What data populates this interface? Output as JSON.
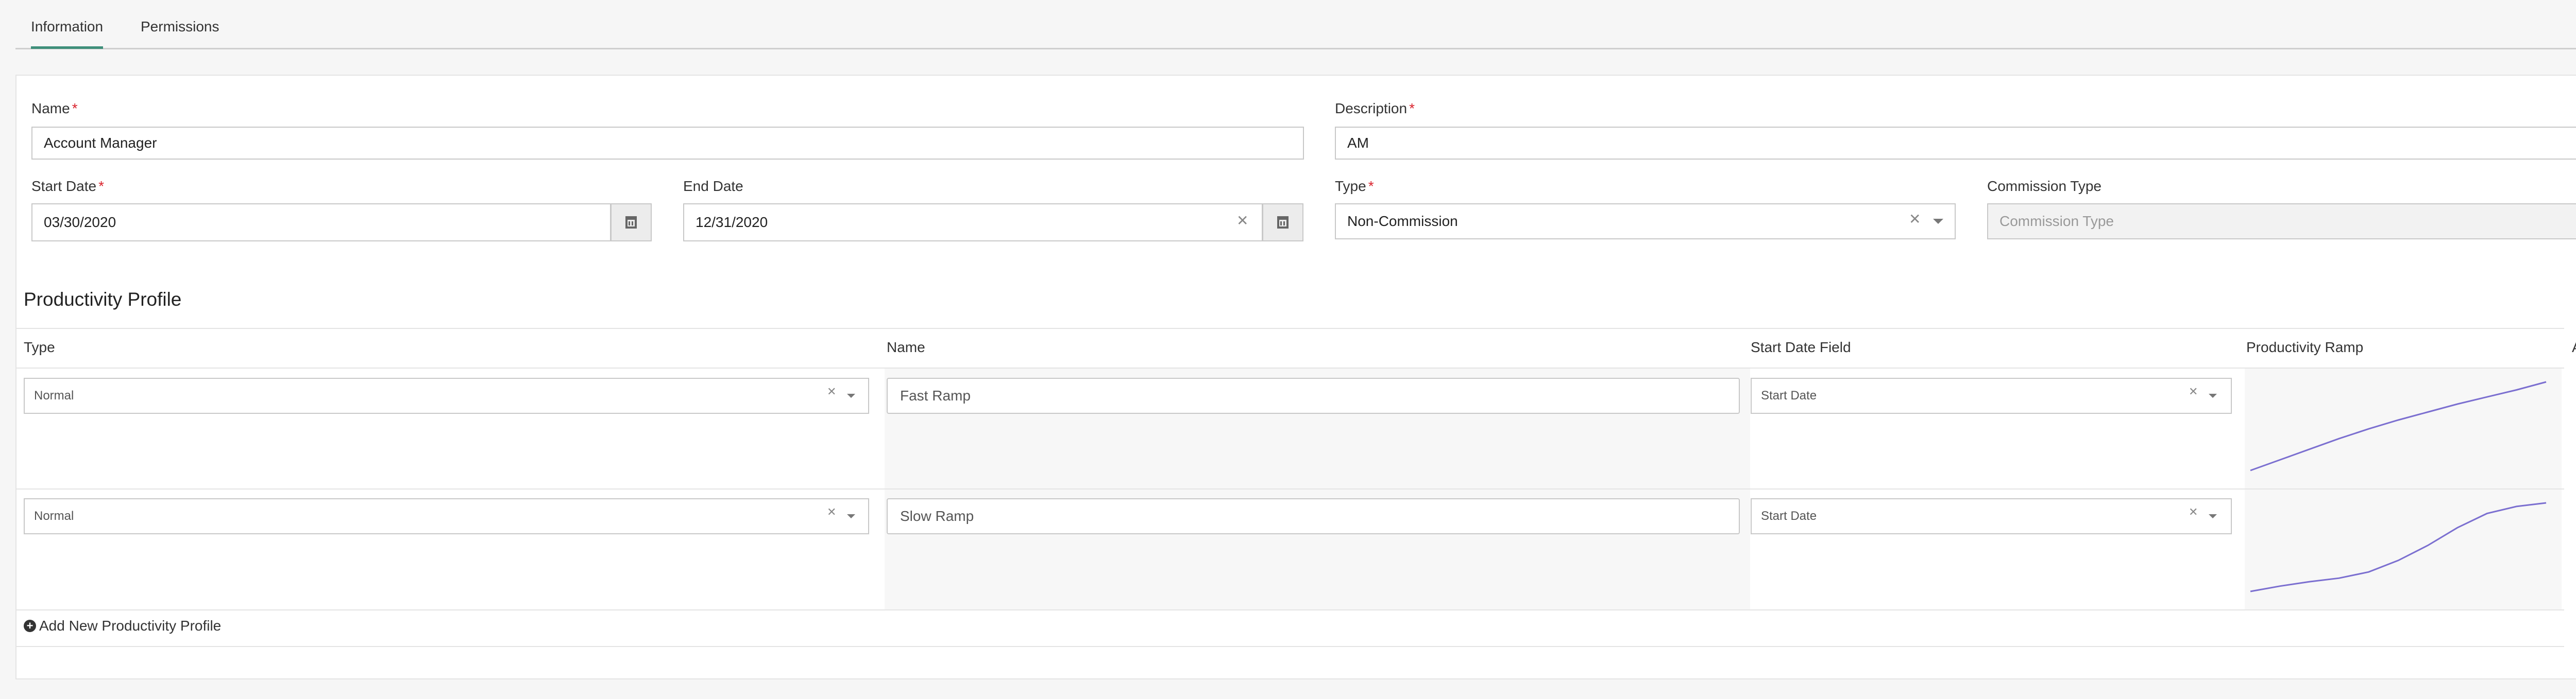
{
  "tabs": [
    {
      "label": "Information",
      "active": true
    },
    {
      "label": "Permissions",
      "active": false
    }
  ],
  "form": {
    "name": {
      "label": "Name",
      "value": "Account Manager"
    },
    "description": {
      "label": "Description",
      "value": "AM"
    },
    "start_date": {
      "label": "Start Date",
      "value": "03/30/2020"
    },
    "end_date": {
      "label": "End Date",
      "value": "12/31/2020"
    },
    "type": {
      "label": "Type",
      "value": "Non-Commission"
    },
    "commission_type": {
      "label": "Commission Type",
      "placeholder": "Commission Type"
    }
  },
  "productivity": {
    "title": "Productivity Profile",
    "columns": [
      "Type",
      "Name",
      "Start Date Field",
      "Productivity Ramp",
      "Action"
    ],
    "rows": [
      {
        "type": "Normal",
        "name": "Fast Ramp",
        "start_date_field": "Start Date",
        "ramp": [
          0.0,
          0.12,
          0.24,
          0.36,
          0.47,
          0.57,
          0.66,
          0.75,
          0.83,
          0.91,
          1.0
        ]
      },
      {
        "type": "Normal",
        "name": "Slow Ramp",
        "start_date_field": "Start Date",
        "ramp": [
          0.0,
          0.06,
          0.11,
          0.15,
          0.22,
          0.35,
          0.52,
          0.72,
          0.88,
          0.96,
          1.0
        ]
      }
    ],
    "add_label": "Add New Productivity Profile"
  },
  "colors": {
    "accent": "#3f8f7a",
    "required": "#d9232d",
    "ramp_line": "#7b6fd0"
  },
  "icons": [
    "calendar-icon",
    "clear-icon",
    "chevron-down-icon",
    "edit-icon",
    "trash-icon",
    "plus-circle-icon"
  ]
}
